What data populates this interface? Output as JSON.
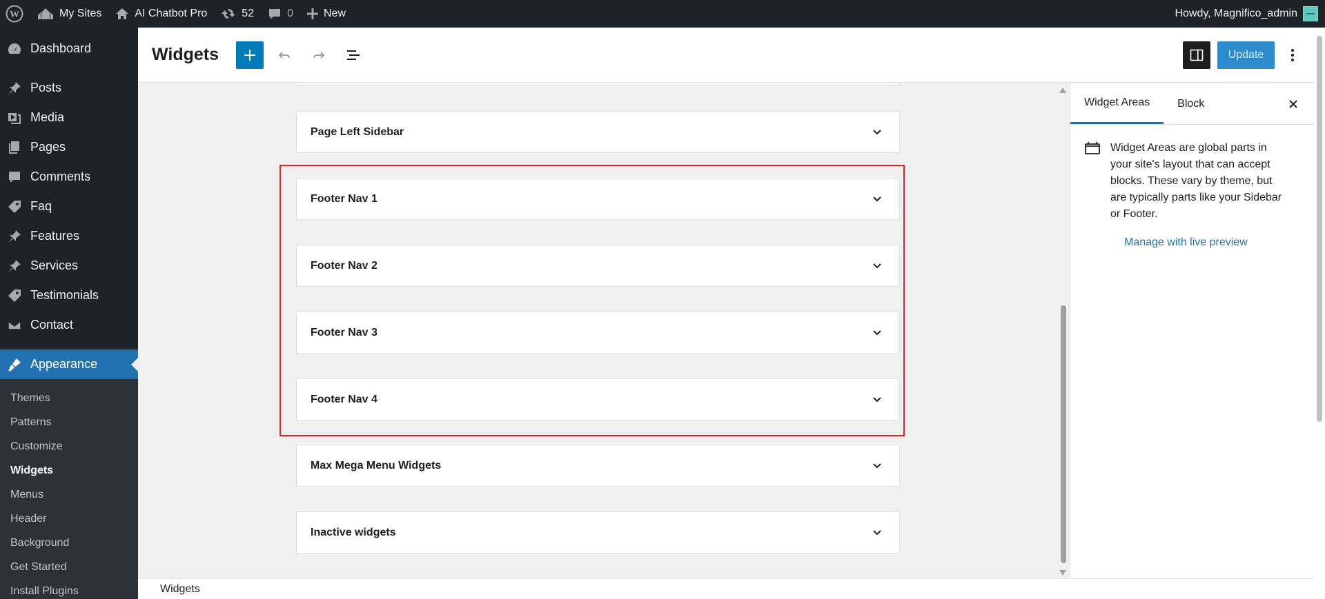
{
  "adminbar": {
    "my_sites": "My Sites",
    "site_name": "AI Chatbot Pro",
    "updates_count": "52",
    "comments_count": "0",
    "new_label": "New",
    "howdy": "Howdy, Magnifico_admin"
  },
  "menu": {
    "items": [
      {
        "label": "Dashboard",
        "icon": "dashboard-icon"
      },
      {
        "label": "Posts",
        "icon": "pin-icon"
      },
      {
        "label": "Media",
        "icon": "media-icon"
      },
      {
        "label": "Pages",
        "icon": "pages-icon"
      },
      {
        "label": "Comments",
        "icon": "comment-icon"
      },
      {
        "label": "Faq",
        "icon": "tag-icon"
      },
      {
        "label": "Features",
        "icon": "pin-icon"
      },
      {
        "label": "Services",
        "icon": "pin-icon"
      },
      {
        "label": "Testimonials",
        "icon": "tag-icon"
      },
      {
        "label": "Contact",
        "icon": "mail-icon"
      }
    ],
    "current": {
      "label": "Appearance",
      "icon": "brush-icon"
    },
    "submenu": [
      "Themes",
      "Patterns",
      "Customize",
      "Widgets",
      "Menus",
      "Header",
      "Background",
      "Get Started",
      "Install Plugins"
    ],
    "submenu_current": "Widgets"
  },
  "header": {
    "title": "Widgets",
    "update_label": "Update"
  },
  "widget_areas": [
    {
      "label": "Page Left Sidebar"
    },
    {
      "label": "Footer Nav 1"
    },
    {
      "label": "Footer Nav 2"
    },
    {
      "label": "Footer Nav 3"
    },
    {
      "label": "Footer Nav 4"
    },
    {
      "label": "Max Mega Menu Widgets"
    },
    {
      "label": "Inactive widgets"
    }
  ],
  "sidebar": {
    "tab_areas": "Widget Areas",
    "tab_block": "Block",
    "description": "Widget Areas are global parts in your site's layout that can accept blocks. These vary by theme, but are typically parts like your Sidebar or Footer.",
    "manage_link": "Manage with live preview"
  },
  "footer": {
    "breadcrumb": "Widgets"
  },
  "colors": {
    "accent": "#007cba",
    "admin_dark": "#1d2327",
    "highlight": "#e02424"
  }
}
